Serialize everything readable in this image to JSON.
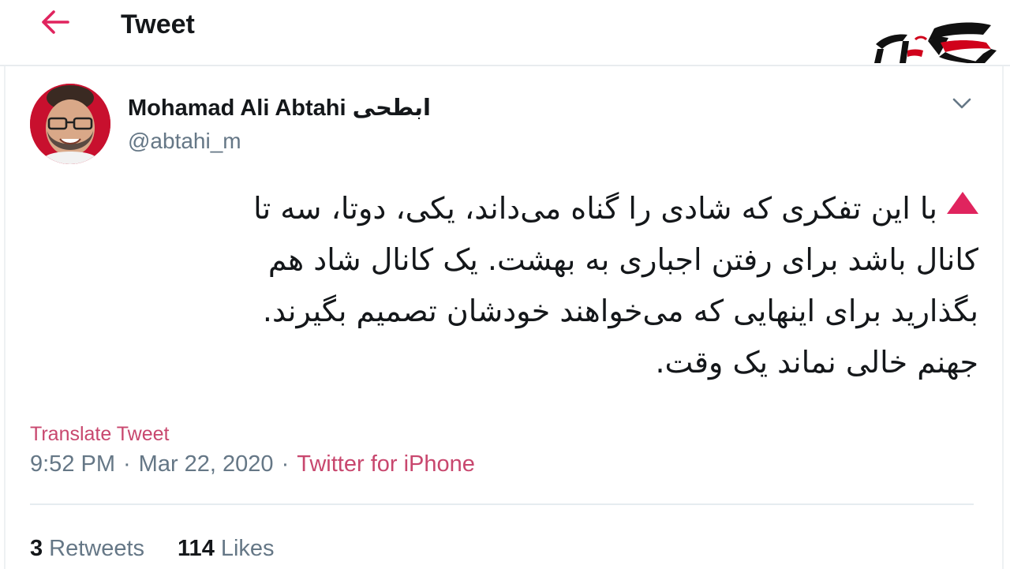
{
  "header": {
    "title": "Tweet",
    "back_icon": "arrow-left-icon",
    "accent_color": "#e0245e"
  },
  "brand": {
    "logo_icon": "rokna-logo",
    "colors": [
      "#111111",
      "#d0021b"
    ]
  },
  "author": {
    "name": "Mohamad Ali Abtahi ابطحی",
    "handle": "@abtahi_m",
    "avatar_icon": "profile-photo"
  },
  "tweet": {
    "lines": [
      "با این تفکری که شادی را گناه می‌داند، یکی، دوتا، سه تا",
      "کانال باشد برای رفتن اجباری به بهشت. یک کانال شاد هم",
      "بگذارید برای اینهایی که می‌خواهند خودشان تصمیم بگیرند.",
      "جهنم خالی نماند یک وقت."
    ],
    "marker_icon": "red-triangle-icon",
    "translate_label": "Translate Tweet",
    "time": "9:52 PM",
    "date": "Mar 22, 2020",
    "separator": "·",
    "source": "Twitter for iPhone"
  },
  "stats": {
    "retweets_count": "3",
    "retweets_label": "Retweets",
    "likes_count": "114",
    "likes_label": "Likes"
  }
}
